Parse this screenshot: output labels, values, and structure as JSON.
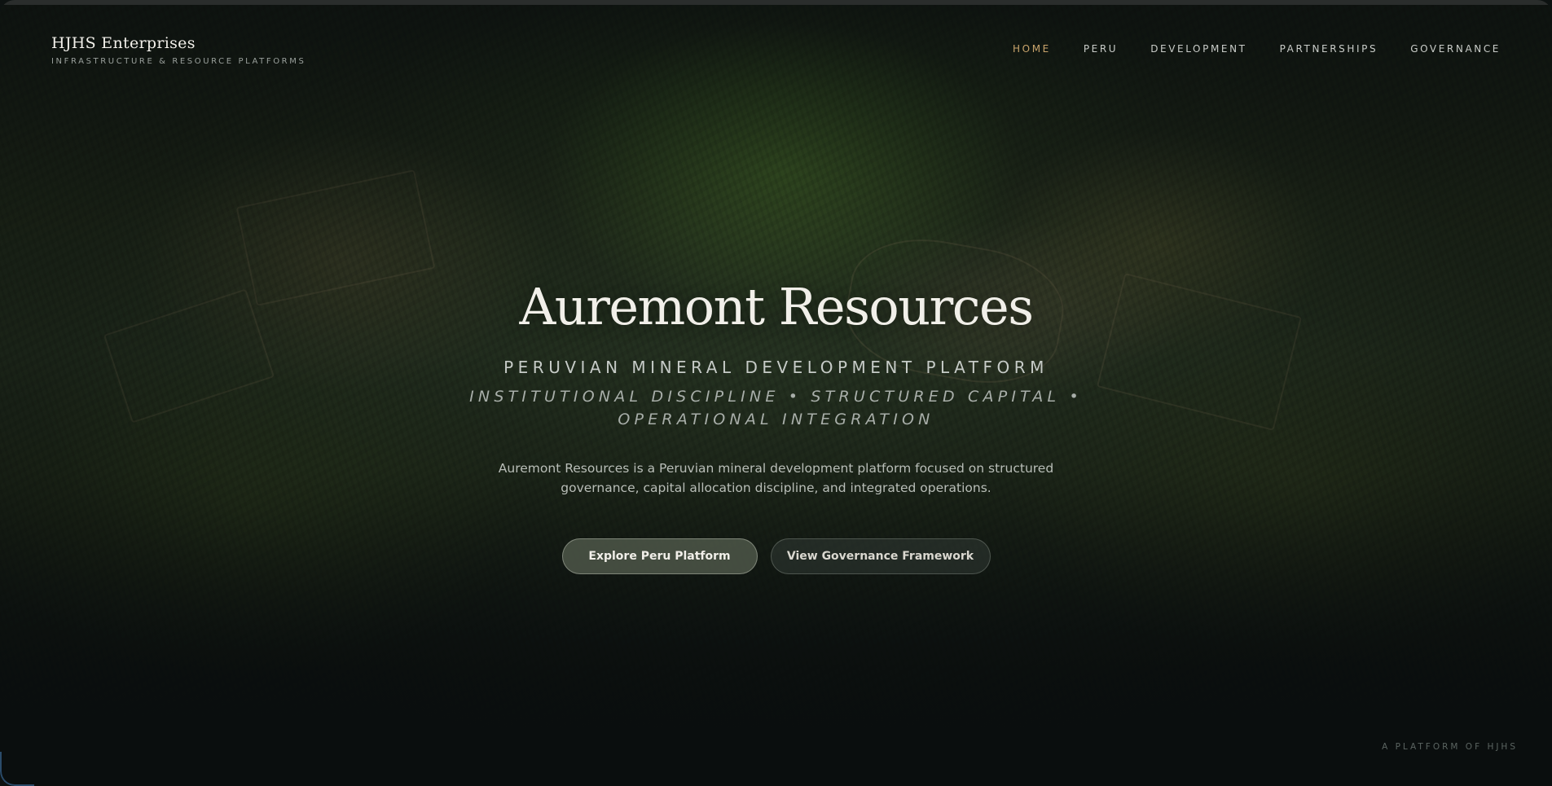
{
  "brand": {
    "name": "HJHS Enterprises",
    "tagline": "INFRASTRUCTURE & RESOURCE PLATFORMS"
  },
  "nav": {
    "items": [
      {
        "label": "HOME",
        "active": true
      },
      {
        "label": "PERU",
        "active": false
      },
      {
        "label": "DEVELOPMENT",
        "active": false
      },
      {
        "label": "PARTNERSHIPS",
        "active": false
      },
      {
        "label": "GOVERNANCE",
        "active": false
      }
    ]
  },
  "hero": {
    "title": "Auremont Resources",
    "subtitle": "PERUVIAN MINERAL DEVELOPMENT PLATFORM",
    "tagline": "INSTITUTIONAL DISCIPLINE • STRUCTURED CAPITAL • OPERATIONAL INTEGRATION",
    "description": "Auremont Resources is a Peruvian mineral development platform focused on structured governance, capital allocation discipline, and integrated operations.",
    "primary_cta": "Explore Peru Platform",
    "secondary_cta": "View Governance Framework"
  },
  "footer": {
    "note": "A PLATFORM OF HJHS"
  },
  "colors": {
    "accent": "#c9a46b",
    "background": "#0d1211",
    "text": "#f1efe9"
  }
}
